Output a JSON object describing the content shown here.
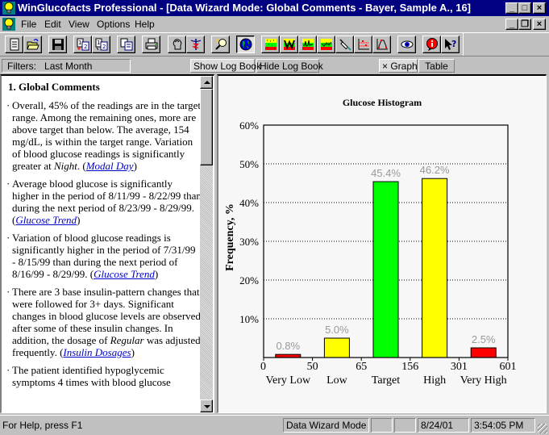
{
  "window": {
    "title": "WinGlucofacts Professional - [Data Wizard Mode: Global Comments - Bayer, Sample A., 16]",
    "controls": {
      "minimize": "_",
      "maximize": "□",
      "close": "×",
      "restore": "❐"
    }
  },
  "menu": {
    "items": [
      {
        "label": "File",
        "accel": "F"
      },
      {
        "label": "Edit",
        "accel": "E"
      },
      {
        "label": "View",
        "accel": "V"
      },
      {
        "label": "Options",
        "accel": "O"
      },
      {
        "label": "Help",
        "accel": "H"
      }
    ]
  },
  "toolbar": {
    "buttons": [
      {
        "icon": "new-document-icon"
      },
      {
        "icon": "open-folder-icon"
      },
      {
        "icon": "save-disk-icon"
      },
      {
        "icon": "add-page-icon"
      },
      {
        "icon": "edit-page-icon"
      },
      {
        "icon": "copy-icon"
      },
      {
        "icon": "print-icon"
      },
      {
        "icon": "patient-head-icon"
      },
      {
        "icon": "caduceus-icon"
      },
      {
        "icon": "magnifier-icon"
      },
      {
        "icon": "globe-icon",
        "pressed": true
      },
      {
        "icon": "glucose-range-chart-icon"
      },
      {
        "icon": "modal-day-chart-icon"
      },
      {
        "icon": "glucose-trend-chart-icon"
      },
      {
        "icon": "trend-overlay-chart-icon"
      },
      {
        "icon": "syringe-icon"
      },
      {
        "icon": "scatter-plot-icon"
      },
      {
        "icon": "distribution-plot-icon"
      },
      {
        "icon": "eye-icon"
      },
      {
        "icon": "info-icon"
      },
      {
        "icon": "context-help-icon"
      }
    ]
  },
  "filterbar": {
    "filters_label": "Filters:",
    "filters_value": "Last Month",
    "show_log_book": "Show Log Book",
    "hide_log_book": "Hide Log Book",
    "graph_tab": "× Graph",
    "table_tab": "Table"
  },
  "comments": {
    "section_title": "1. Global Comments",
    "items": [
      {
        "text": "Overall, 45% of the readings are in the target range. Among the remaining ones, more are above target than below. The average, 154 mg/dL, is within the target range. Variation of blood glucose readings is significantly greater at ",
        "emph": "Night",
        "after": ". (",
        "link": "Modal Day",
        "close": ")"
      },
      {
        "text": "Average blood glucose is significantly higher in the period of 8/11/99 - 8/22/99 than during the next period of 8/23/99 - 8/29/99. (",
        "link": "Glucose Trend",
        "close": ")"
      },
      {
        "text": "Variation of blood glucose readings is significantly higher in the period of 7/31/99 - 8/15/99 than during the next period of 8/16/99 - 8/29/99. (",
        "link": "Glucose Trend",
        "close": ")"
      },
      {
        "text": "There are 3 base insulin-pattern changes that were followed for 3+ days. Significant changes in blood glucose levels are observed after some of these insulin changes. In addition, the dosage of ",
        "emph": "Regular",
        "after": " was adjusted frequently. (",
        "link": "Insulin Dosages",
        "close": ")"
      },
      {
        "text": "The patient identified hypoglycemic symptoms 4 times with blood glucose"
      }
    ]
  },
  "chart_data": {
    "type": "bar",
    "title": "Glucose Histogram",
    "xlabel": "",
    "ylabel": "Frequency, %",
    "ylim": [
      0,
      60
    ],
    "yticks": [
      "0%",
      "10%",
      "20%",
      "30%",
      "40%",
      "50%",
      "60%"
    ],
    "ytick_values": [
      0,
      10,
      20,
      30,
      40,
      50,
      60
    ],
    "grid": "horizontal-dotted",
    "boundary_ticks": [
      "0",
      "50",
      "65",
      "156",
      "301",
      "601"
    ],
    "categories": [
      "Very Low",
      "Low",
      "Target",
      "High",
      "Very High"
    ],
    "values": [
      0.8,
      5.0,
      45.4,
      46.2,
      2.5
    ],
    "value_labels": [
      "0.8%",
      "5.0%",
      "45.4%",
      "46.2%",
      "2.5%"
    ],
    "colors": [
      "#ff0000",
      "#ffff00",
      "#00ff00",
      "#ffff00",
      "#ff0000"
    ]
  },
  "status": {
    "help": "For Help, press F1",
    "mode": "Data Wizard Mode",
    "blank1": "",
    "blank2": "",
    "date": "8/24/01",
    "time": "3:54:05 PM"
  },
  "colors": {
    "titlebar": "#000080",
    "face": "#c0c0c0",
    "link": "#0000cc",
    "value_label": "#999999"
  }
}
